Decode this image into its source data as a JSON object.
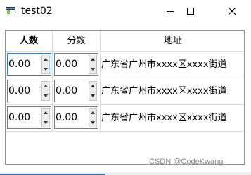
{
  "window": {
    "title": "test02",
    "icon": "app-window-icon"
  },
  "table": {
    "headers": [
      "人数",
      "分数",
      "地址"
    ],
    "rows": [
      {
        "people": "0.00",
        "score": "0.00",
        "address": "广东省广州市xxxx区xxxx街道"
      },
      {
        "people": "0.00",
        "score": "0.00",
        "address": "广东省广州市xxxx区xxxx街道"
      },
      {
        "people": "0.00",
        "score": "0.00",
        "address": "广东省广州市xxxx区xxxx街道"
      }
    ]
  },
  "watermark": "CSDN @CodeKwang",
  "colors": {
    "focus_border": "#3c7fb1",
    "grid_line": "#dcdcdc"
  }
}
